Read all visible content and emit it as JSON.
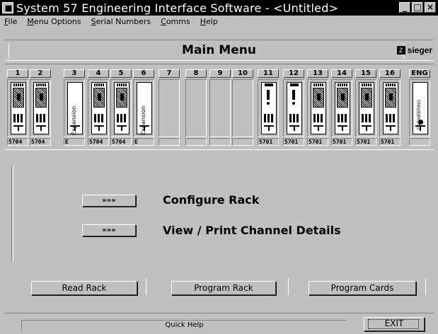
{
  "window": {
    "title": "System 57 Engineering Interface Software - <Untitled>",
    "min_label": "_",
    "max_label": "□",
    "close_label": "×"
  },
  "menu": [
    {
      "label": "File",
      "u": "F",
      "rest": "ile"
    },
    {
      "label": "Menu Options",
      "u": "M",
      "rest": "enu Options"
    },
    {
      "label": "Serial Numbers",
      "u": "S",
      "rest": "erial Numbers"
    },
    {
      "label": "Comms",
      "u": "C",
      "rest": "omms"
    },
    {
      "label": "Help",
      "u": "H",
      "rest": "elp"
    }
  ],
  "header": {
    "title": "Main Menu",
    "logo_mark": "Z",
    "logo_text": "sieger"
  },
  "rack": {
    "slots": [
      {
        "num": "1",
        "type": "detector",
        "code": "5704"
      },
      {
        "num": "2",
        "type": "detector",
        "code": "5704"
      },
      {
        "num": "3",
        "type": "expansion",
        "code": "E",
        "label": "Expansion"
      },
      {
        "num": "4",
        "type": "detector",
        "code": "5704"
      },
      {
        "num": "5",
        "type": "detector",
        "code": "5704"
      },
      {
        "num": "6",
        "type": "expansion",
        "code": "E",
        "label": "Expansion"
      },
      {
        "num": "7",
        "type": "empty",
        "code": ""
      },
      {
        "num": "8",
        "type": "empty",
        "code": ""
      },
      {
        "num": "9",
        "type": "empty",
        "code": ""
      },
      {
        "num": "10",
        "type": "empty",
        "code": ""
      },
      {
        "num": "11",
        "type": "control",
        "code": "5701"
      },
      {
        "num": "12",
        "type": "control",
        "code": "5701"
      },
      {
        "num": "13",
        "type": "detector",
        "code": "5701"
      },
      {
        "num": "14",
        "type": "detector",
        "code": "5701"
      },
      {
        "num": "15",
        "type": "detector",
        "code": "5701"
      },
      {
        "num": "16",
        "type": "detector",
        "code": "5701"
      },
      {
        "num": "ENG",
        "type": "eng",
        "code": "",
        "label": "ENGINEERING"
      }
    ]
  },
  "actions": {
    "configure": {
      "button": "»»»",
      "label": "Configure Rack"
    },
    "view_print": {
      "button": "»»»",
      "label": "View / Print Channel Details"
    }
  },
  "buttons": {
    "read_rack": "Read Rack",
    "program_rack": "Program Rack",
    "program_cards": "Program Cards"
  },
  "status": {
    "quick_help": "Quick Help",
    "exit": "EXIT"
  }
}
